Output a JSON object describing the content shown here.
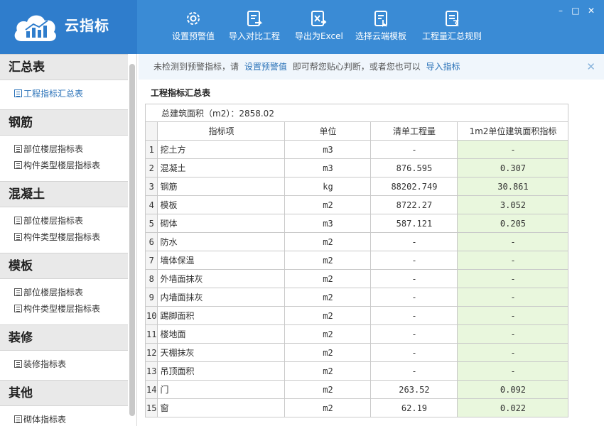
{
  "app": {
    "title": "云指标"
  },
  "toolbar": [
    {
      "label": "设置预警值",
      "icon": "gear-icon"
    },
    {
      "label": "导入对比工程",
      "icon": "import-compare-icon"
    },
    {
      "label": "导出为Excel",
      "icon": "excel-export-icon"
    },
    {
      "label": "选择云端模板",
      "icon": "cloud-template-icon"
    },
    {
      "label": "工程量汇总规则",
      "icon": "summary-rules-icon"
    }
  ],
  "window": {
    "minimize": "–",
    "maximize": "□",
    "close": "✕"
  },
  "sidebar": {
    "sections": [
      {
        "title": "汇总表",
        "items": [
          "工程指标汇总表"
        ]
      },
      {
        "title": "钢筋",
        "items": [
          "部位楼层指标表",
          "构件类型楼层指标表"
        ]
      },
      {
        "title": "混凝土",
        "items": [
          "部位楼层指标表",
          "构件类型楼层指标表"
        ]
      },
      {
        "title": "模板",
        "items": [
          "部位楼层指标表",
          "构件类型楼层指标表"
        ]
      },
      {
        "title": "装修",
        "items": [
          "装修指标表"
        ]
      },
      {
        "title": "其他",
        "items": [
          "砌体指标表"
        ]
      }
    ]
  },
  "notice": {
    "text1": "未检测到预警指标，请",
    "link1": "设置预警值",
    "text2": "即可帮您贴心判断，或者您也可以",
    "link2": "导入指标",
    "close": "✕"
  },
  "table": {
    "title": "工程指标汇总表",
    "area": "总建筑面积（m2）：2858.02",
    "headers": [
      "指标项",
      "单位",
      "清单工程量",
      "1m2单位建筑面积指标"
    ],
    "rows": [
      {
        "n": "1",
        "name": "挖土方",
        "unit": "m3",
        "qty": "-",
        "idx": "-"
      },
      {
        "n": "2",
        "name": "混凝土",
        "unit": "m3",
        "qty": "876.595",
        "idx": "0.307"
      },
      {
        "n": "3",
        "name": "钢筋",
        "unit": "kg",
        "qty": "88202.749",
        "idx": "30.861"
      },
      {
        "n": "4",
        "name": "模板",
        "unit": "m2",
        "qty": "8722.27",
        "idx": "3.052"
      },
      {
        "n": "5",
        "name": "砌体",
        "unit": "m3",
        "qty": "587.121",
        "idx": "0.205"
      },
      {
        "n": "6",
        "name": "防水",
        "unit": "m2",
        "qty": "-",
        "idx": "-"
      },
      {
        "n": "7",
        "name": "墙体保温",
        "unit": "m2",
        "qty": "-",
        "idx": "-"
      },
      {
        "n": "8",
        "name": "外墙面抹灰",
        "unit": "m2",
        "qty": "-",
        "idx": "-"
      },
      {
        "n": "9",
        "name": "内墙面抹灰",
        "unit": "m2",
        "qty": "-",
        "idx": "-"
      },
      {
        "n": "10",
        "name": "踢脚面积",
        "unit": "m2",
        "qty": "-",
        "idx": "-"
      },
      {
        "n": "11",
        "name": "楼地面",
        "unit": "m2",
        "qty": "-",
        "idx": "-"
      },
      {
        "n": "12",
        "name": "天棚抹灰",
        "unit": "m2",
        "qty": "-",
        "idx": "-"
      },
      {
        "n": "13",
        "name": "吊顶面积",
        "unit": "m2",
        "qty": "-",
        "idx": "-"
      },
      {
        "n": "14",
        "name": "门",
        "unit": "m2",
        "qty": "263.52",
        "idx": "0.092"
      },
      {
        "n": "15",
        "name": "窗",
        "unit": "m2",
        "qty": "62.19",
        "idx": "0.022"
      }
    ]
  },
  "colors": {
    "header": "#3a8bd5",
    "logo_bg": "#2f7dcc",
    "link": "#2a72b8",
    "index_cell": "#e9f7dd"
  }
}
